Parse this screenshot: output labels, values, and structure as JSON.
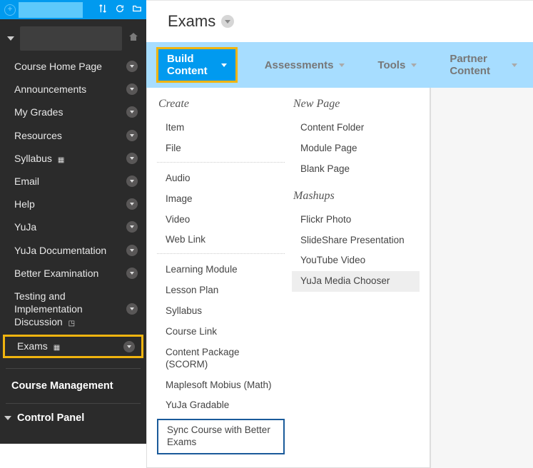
{
  "topbar": {
    "add_tooltip": "Add"
  },
  "sidebar": {
    "course_management": "Course Management",
    "control_panel": "Control Panel",
    "items": [
      {
        "label": "Course Home Page"
      },
      {
        "label": "Announcements"
      },
      {
        "label": "My Grades"
      },
      {
        "label": "Resources"
      },
      {
        "label": "Syllabus",
        "glyph": "▦"
      },
      {
        "label": "Email"
      },
      {
        "label": "Help"
      },
      {
        "label": "YuJa"
      },
      {
        "label": "YuJa Documentation"
      },
      {
        "label": "Better Examination"
      },
      {
        "label": "Testing and Implementation Discussion",
        "glyph": "◳"
      },
      {
        "label": "Exams",
        "glyph": "▦",
        "highlight": true
      }
    ]
  },
  "page": {
    "title": "Exams"
  },
  "actionbar": {
    "build_content": "Build Content",
    "assessments": "Assessments",
    "tools": "Tools",
    "partner_content": "Partner Content"
  },
  "dropdown": {
    "create": {
      "heading": "Create",
      "group1": [
        "Item",
        "File"
      ],
      "group2": [
        "Audio",
        "Image",
        "Video",
        "Web Link"
      ],
      "group3": [
        "Learning Module",
        "Lesson Plan",
        "Syllabus",
        "Course Link",
        "Content Package (SCORM)",
        "Maplesoft Mobius (Math)",
        "YuJa Gradable"
      ],
      "boxed": "Sync Course with Better Exams"
    },
    "newpage": {
      "heading": "New Page",
      "items": [
        "Content Folder",
        "Module Page",
        "Blank Page"
      ]
    },
    "mashups": {
      "heading": "Mashups",
      "items": [
        "Flickr Photo",
        "SlideShare Presentation",
        "YouTube Video",
        "YuJa Media Chooser"
      ]
    }
  }
}
